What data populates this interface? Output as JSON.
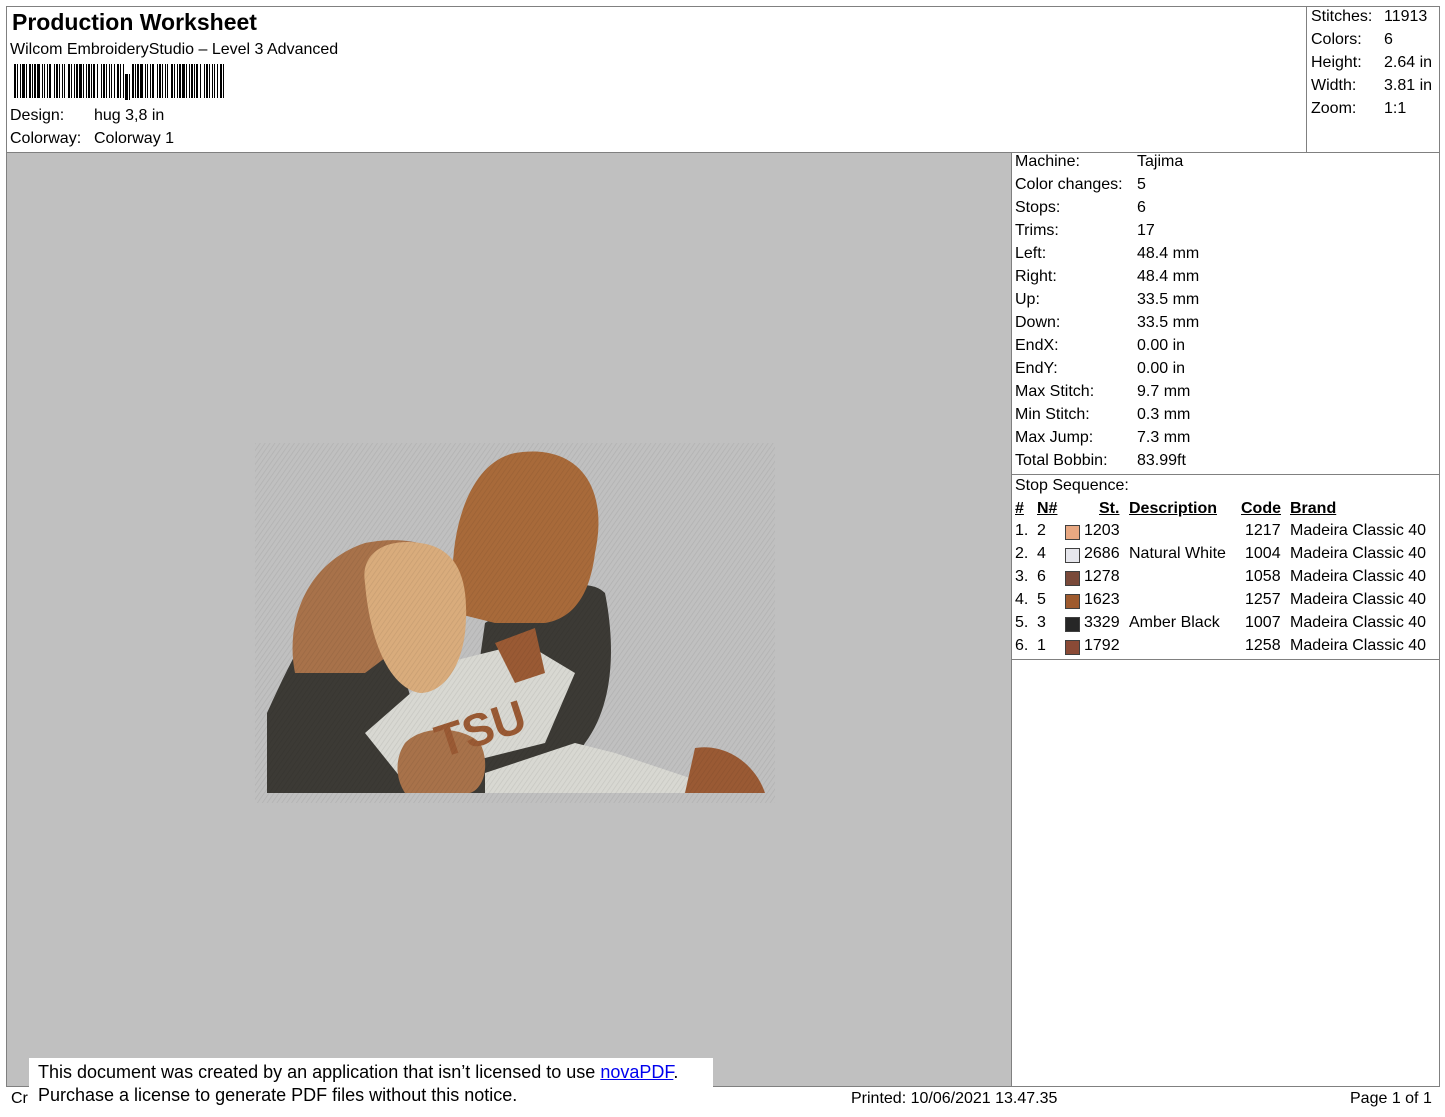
{
  "header": {
    "title": "Production Worksheet",
    "subtitle": "Wilcom EmbroideryStudio – Level 3 Advanced",
    "barcode_icon": "barcode-icon",
    "design_label": "Design:",
    "design_value": "hug 3,8 in",
    "colorway_label": "Colorway:",
    "colorway_value": "Colorway 1"
  },
  "stats": [
    {
      "label": "Stitches:",
      "value": "11913"
    },
    {
      "label": "Colors:",
      "value": "6"
    },
    {
      "label": "Height:",
      "value": "2.64 in"
    },
    {
      "label": "Width:",
      "value": "3.81 in"
    },
    {
      "label": "Zoom:",
      "value": "1:1"
    }
  ],
  "machine_info": [
    {
      "label": "Machine:",
      "value": "Tajima"
    },
    {
      "label": "Color changes:",
      "value": "5"
    },
    {
      "label": "Stops:",
      "value": "6"
    },
    {
      "label": "Trims:",
      "value": "17"
    },
    {
      "label": "Left:",
      "value": "48.4 mm"
    },
    {
      "label": "Right:",
      "value": "48.4 mm"
    },
    {
      "label": "Up:",
      "value": "33.5 mm"
    },
    {
      "label": "Down:",
      "value": "33.5 mm"
    },
    {
      "label": "EndX:",
      "value": "0.00 in"
    },
    {
      "label": "EndY:",
      "value": "0.00 in"
    },
    {
      "label": "Max Stitch:",
      "value": "9.7 mm"
    },
    {
      "label": "Min Stitch:",
      "value": "0.3 mm"
    },
    {
      "label": "Max Jump:",
      "value": "7.3 mm"
    },
    {
      "label": "Total Bobbin:",
      "value": "83.99ft"
    }
  ],
  "stop_sequence": {
    "title": "Stop Sequence:",
    "headers": {
      "num": "#",
      "n": "N#",
      "st": "St.",
      "description": "Description",
      "code": "Code",
      "brand": "Brand"
    },
    "rows": [
      {
        "num": "1.",
        "n": "2",
        "color": "#e8a882",
        "st": "1203",
        "description": "",
        "code": "1217",
        "brand": "Madeira Classic 40"
      },
      {
        "num": "2.",
        "n": "4",
        "color": "#e6e6ec",
        "st": "2686",
        "description": "Natural White",
        "code": "1004",
        "brand": "Madeira Classic 40"
      },
      {
        "num": "3.",
        "n": "6",
        "color": "#7a4a3a",
        "st": "1278",
        "description": "",
        "code": "1058",
        "brand": "Madeira Classic 40"
      },
      {
        "num": "4.",
        "n": "5",
        "color": "#9e5a2e",
        "st": "1623",
        "description": "",
        "code": "1257",
        "brand": "Madeira Classic 40"
      },
      {
        "num": "5.",
        "n": "3",
        "color": "#262626",
        "st": "3329",
        "description": "Amber Black",
        "code": "1007",
        "brand": "Madeira Classic 40"
      },
      {
        "num": "6.",
        "n": "1",
        "color": "#8a4a36",
        "st": "1792",
        "description": "",
        "code": "1258",
        "brand": "Madeira Classic 40"
      }
    ]
  },
  "embroidery": {
    "icon": "embroidery-design-image",
    "logo_text": "TSU",
    "colors": {
      "skin_light": "#d9ac7c",
      "skin_dark": "#a86a3a",
      "hair": "#a8724a",
      "jacket": "#3c3a35",
      "shirt": "#d8d8d2",
      "tie": "#9a5a34"
    }
  },
  "footer": {
    "left_fragment": "Cr",
    "printed": "Printed: 10/06/2021 13.47.35",
    "page": "Page 1 of 1"
  },
  "notice": {
    "line1_prefix": "This document was created by an application that isn’t licensed to use ",
    "link": "novaPDF",
    "line1_suffix": ".",
    "line2": "Purchase a license to generate PDF files without this notice."
  }
}
